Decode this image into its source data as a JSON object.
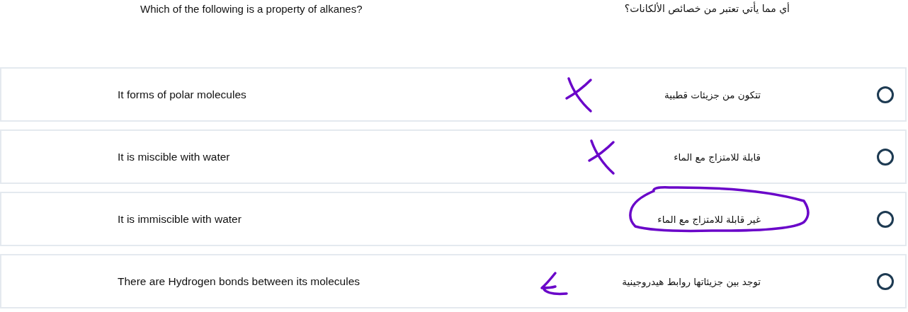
{
  "question": {
    "english": "Which of the following is a property of alkanes?",
    "arabic": "أي مما يأتي تعتبر من خصائص الألكانات؟"
  },
  "options": [
    {
      "english": "It forms of polar molecules",
      "arabic": "تتكون من جزيئات قطبية",
      "selected": false,
      "annotation": {
        "kind": "cross"
      }
    },
    {
      "english": "It is miscible with water",
      "arabic": "قابلة للامتزاج مع الماء",
      "selected": false,
      "annotation": {
        "kind": "cross"
      }
    },
    {
      "english": "It is immiscible with water",
      "arabic": "غير قابلة للامتزاج مع الماء",
      "selected": false,
      "annotation": {
        "kind": "circle"
      }
    },
    {
      "english": "There are Hydrogen bonds between its molecules",
      "arabic": "توجد بين جزيئاتها روابط هيدروجينية",
      "selected": false,
      "annotation": {
        "kind": "tick"
      }
    }
  ]
}
